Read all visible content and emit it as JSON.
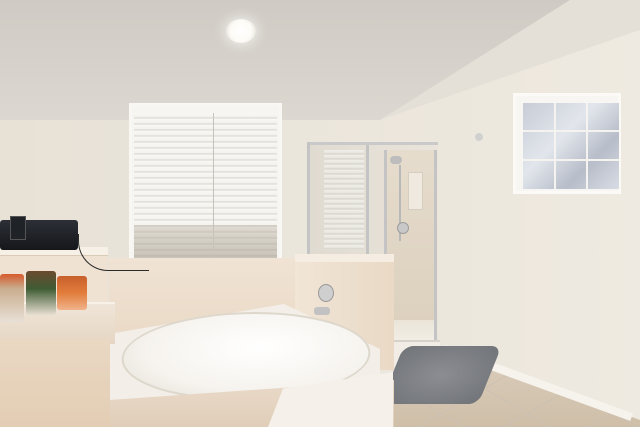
{
  "scene": {
    "kind": "photo",
    "colors": {
      "wall": "#ece7dd",
      "tub": "#f6f3ee",
      "tile": "#ead9c6",
      "floor": "#d4c5b1"
    }
  }
}
